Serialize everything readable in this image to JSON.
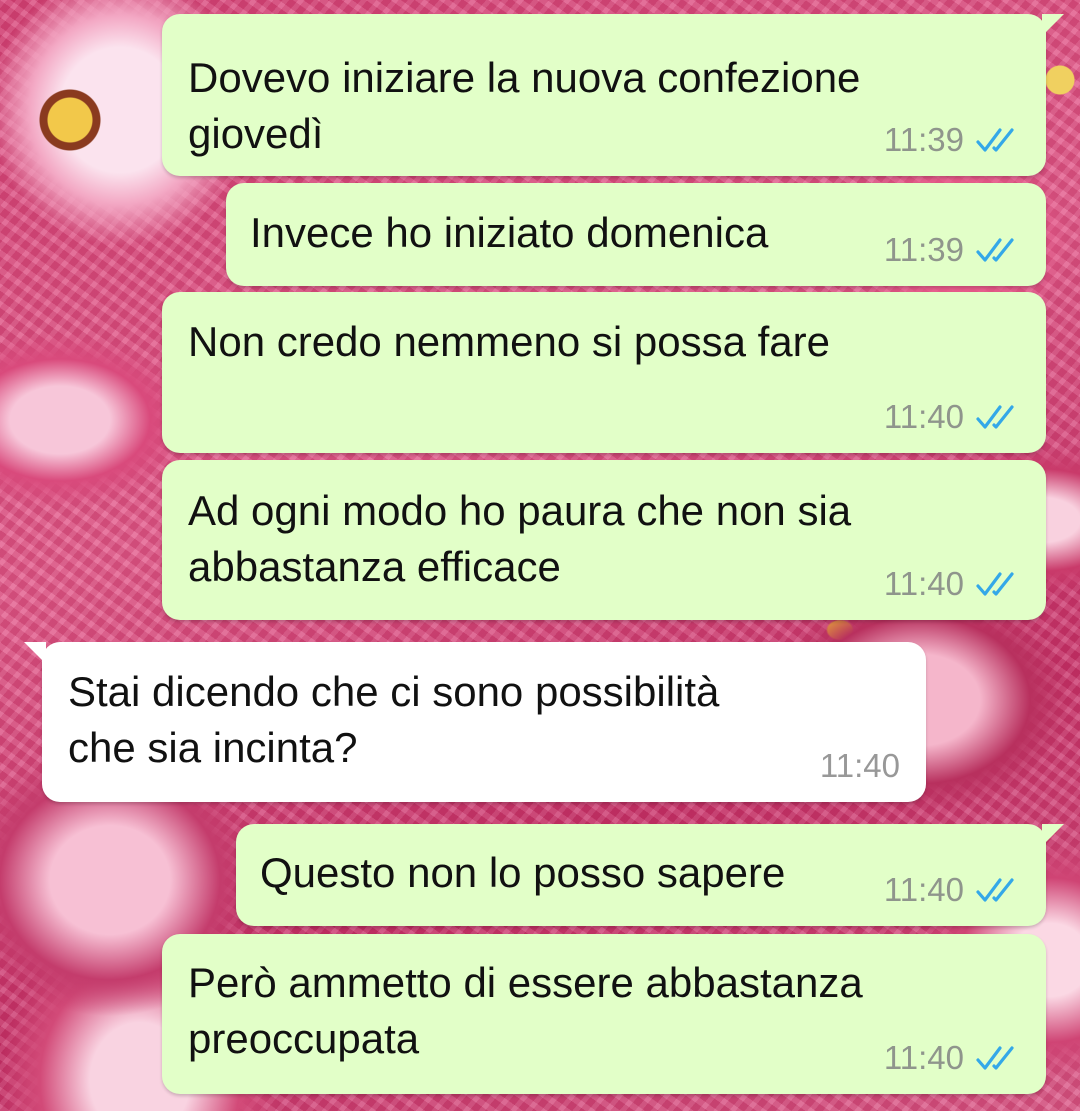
{
  "messages": [
    {
      "text": "Dovevo iniziare la nuova confezione\ngiovedì",
      "time": "11:39",
      "direction": "outgoing",
      "status": "read"
    },
    {
      "text": "Invece ho iniziato domenica",
      "time": "11:39",
      "direction": "outgoing",
      "status": "read"
    },
    {
      "text": "Non credo nemmeno si possa fare",
      "time": "11:40",
      "direction": "outgoing",
      "status": "read"
    },
    {
      "text": "Ad ogni modo ho paura che non sia\nabbastanza efficace",
      "time": "11:40",
      "direction": "outgoing",
      "status": "read"
    },
    {
      "text": "Stai dicendo che ci sono possibilità\nche sia incinta?",
      "time": "11:40",
      "direction": "incoming"
    },
    {
      "text": "Questo non lo posso sapere",
      "time": "11:40",
      "direction": "outgoing",
      "status": "read"
    },
    {
      "text": "Però ammetto di essere abbastanza\npreoccupata",
      "time": "11:40",
      "direction": "outgoing",
      "status": "read"
    }
  ],
  "colors": {
    "outgoing_bubble": "#e2ffc8",
    "incoming_bubble": "#ffffff",
    "read_ticks": "#34a8e8",
    "timestamp": "#8f958c"
  },
  "icons": {
    "read_status": "double-check-icon"
  },
  "wallpaper": "pink-flowers"
}
